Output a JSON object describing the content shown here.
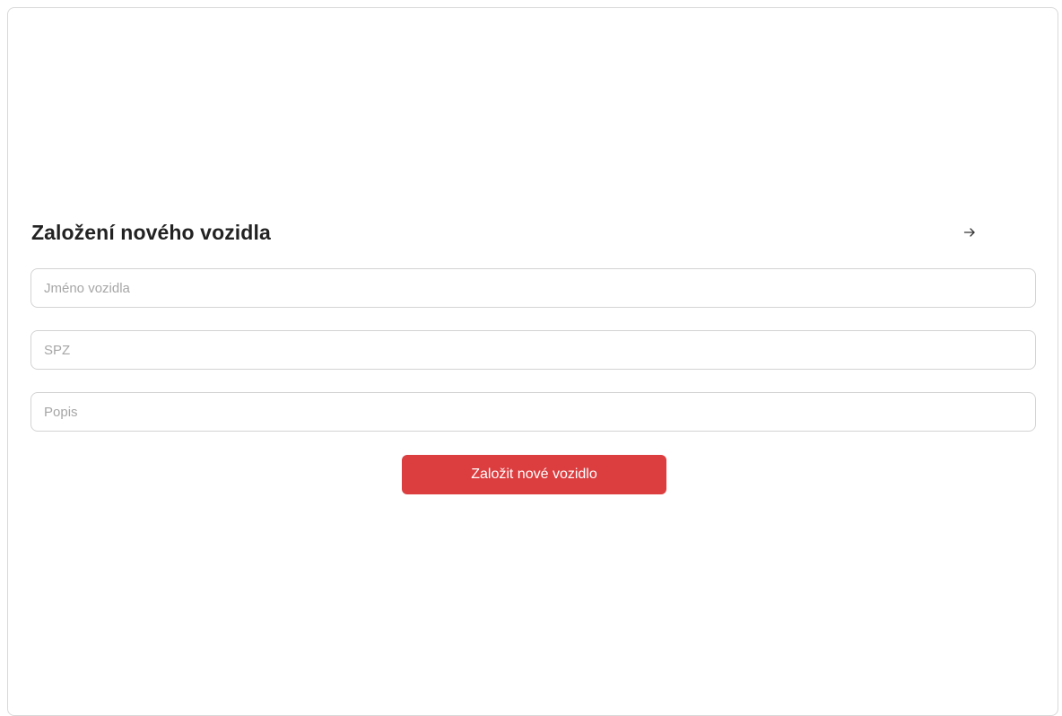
{
  "form": {
    "title": "Založení nového vozidla",
    "name_placeholder": "Jméno vozidla",
    "name_value": "",
    "spz_placeholder": "SPZ",
    "spz_value": "",
    "description_placeholder": "Popis",
    "description_value": "",
    "submit_label": "Založit nové vozidlo"
  },
  "icons": {
    "header_action": "arrow-right-icon"
  },
  "colors": {
    "accent": "#dc3d3f",
    "title_text": "#222222",
    "border": "#d3d3d3",
    "placeholder": "#a6a6a6"
  }
}
